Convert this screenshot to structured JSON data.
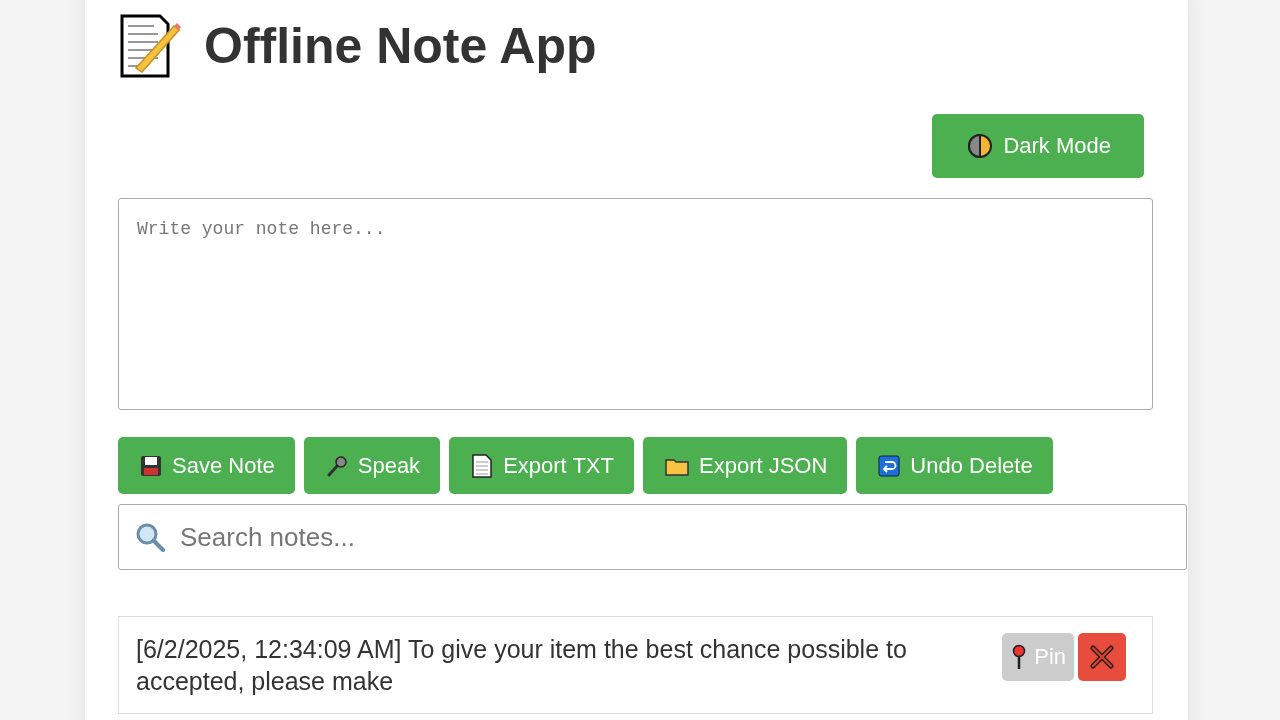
{
  "header": {
    "title": "Offline Note App"
  },
  "theme_button": {
    "label": "Dark Mode"
  },
  "editor": {
    "placeholder": "Write your note here..."
  },
  "actions": [
    {
      "kind": "save",
      "label": "Save Note"
    },
    {
      "kind": "mic",
      "label": "Speak"
    },
    {
      "kind": "doc",
      "label": "Export TXT"
    },
    {
      "kind": "folder",
      "label": "Export JSON"
    },
    {
      "kind": "undo",
      "label": "Undo Delete"
    }
  ],
  "search": {
    "placeholder": "Search notes..."
  },
  "notes": [
    {
      "lines": [
        "[6/2/2025, 12:34:09 AM] To give your item the best chance possible to",
        "accepted, please make"
      ],
      "pinned": false,
      "pin_label": "Pin"
    }
  ]
}
